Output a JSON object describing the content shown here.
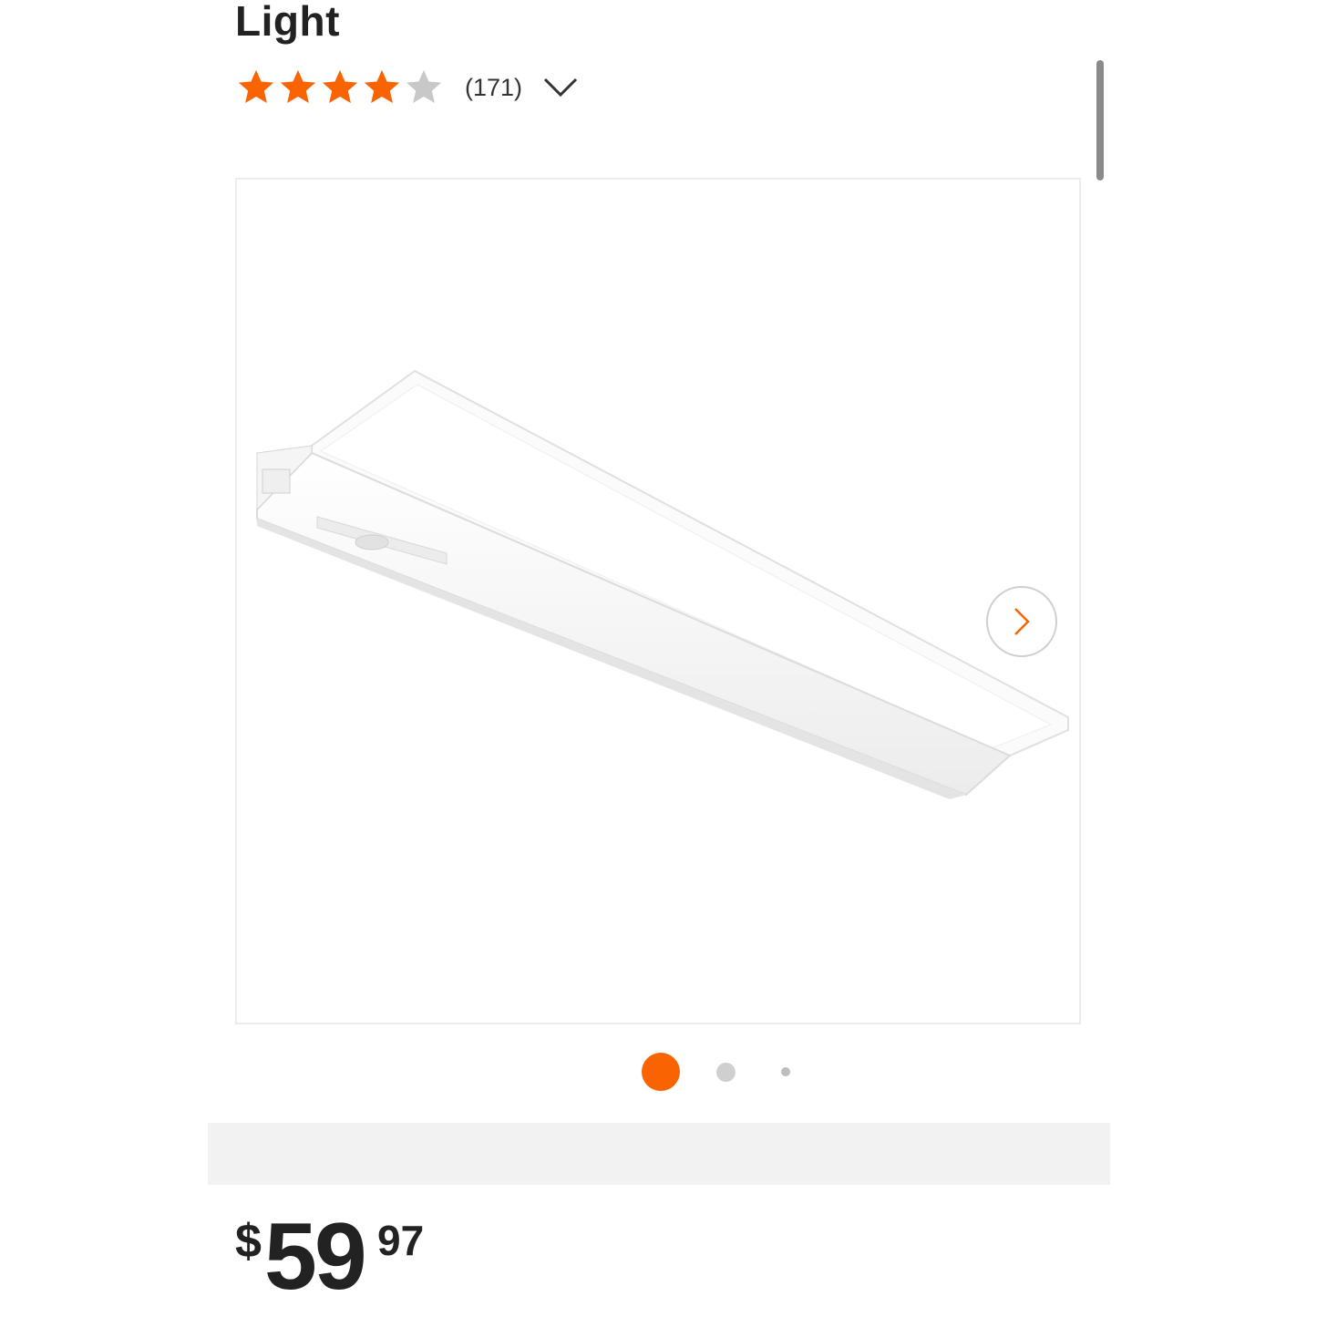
{
  "product": {
    "title": "Light",
    "rating": 4,
    "rating_max": 5,
    "review_count": "(171)"
  },
  "gallery": {
    "image_count": 3,
    "active_index": 0
  },
  "price": {
    "currency": "$",
    "dollars": "59",
    "cents": "97"
  },
  "colors": {
    "accent": "#f96302",
    "star_empty": "#c8c8c8",
    "text": "#222222"
  },
  "icons": {
    "expand": "chevron-down-icon",
    "next": "chevron-right-icon"
  }
}
